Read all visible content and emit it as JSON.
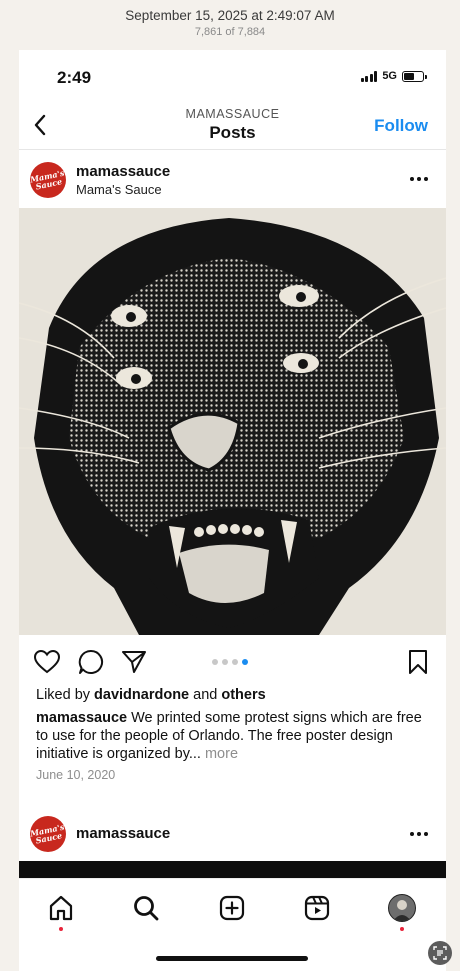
{
  "photos_viewer": {
    "date": "September 15, 2025 at 2:49:07 AM",
    "count": "7,861 of 7,884"
  },
  "status_bar": {
    "time": "2:49",
    "network": "5G",
    "signal_icon": "signal-bars-icon",
    "battery_icon": "battery-icon"
  },
  "header": {
    "account": "MAMASSAUCE",
    "title": "Posts",
    "follow_label": "Follow",
    "back_icon": "chevron-left-icon"
  },
  "post": {
    "username": "mamassauce",
    "location": "Mama's Sauce",
    "avatar_text": "Mama's Sauce",
    "image_description_icon": "panther-illustration-icon",
    "carousel": {
      "count": 4,
      "active_index": 3
    },
    "likes_prefix": "Liked by ",
    "likes_user": "davidnardone",
    "likes_and": " and ",
    "likes_others": "others",
    "caption_user": "mamassauce",
    "caption_text": " We printed some protest signs which are free to use for the people of Orlando. The free poster design initiative is organized by...",
    "caption_more": " more",
    "date": "June 10, 2020"
  },
  "next_post": {
    "username": "mamassauce",
    "avatar_text": "Mama's Sauce"
  },
  "tab_bar": {
    "items": [
      {
        "name": "home",
        "icon": "home-icon",
        "notification": true
      },
      {
        "name": "search",
        "icon": "search-icon",
        "notification": false
      },
      {
        "name": "create",
        "icon": "plus-square-icon",
        "notification": false
      },
      {
        "name": "reels",
        "icon": "reels-icon",
        "notification": false
      },
      {
        "name": "profile",
        "icon": "profile-avatar-icon",
        "notification": true
      }
    ]
  },
  "colors": {
    "accent_blue": "#1a8cf0",
    "brand_red": "#c8281e",
    "notification_red": "#e8243b"
  }
}
